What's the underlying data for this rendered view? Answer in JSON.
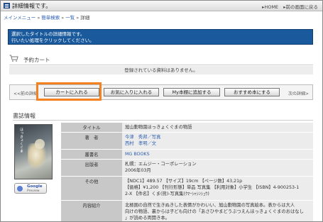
{
  "header": {
    "title": "詳細情報です。",
    "home_link": "▸HOME",
    "back_link": "▸前の画面に戻る"
  },
  "breadcrumb": {
    "items": [
      "メインメニュー",
      "簡単検索",
      "一覧"
    ],
    "separator": "»",
    "current": "詳細"
  },
  "info": {
    "line1": "選択したタイトルの詳細情報です。",
    "line2": "行いたい処理をクリックしてください。"
  },
  "cart": {
    "title": "予約カート",
    "empty_message": "登録されている資料はありません。"
  },
  "buttons": {
    "prev": "<<前の詳細",
    "next": "次の詳細>",
    "add_cart": "カートに入れる",
    "favorite": "お気に入りに入れる",
    "bookshelf": "My本棚に追加する",
    "recommend": "おすすめ本にする"
  },
  "book": {
    "section_title": "書誌情報",
    "cover_text": "ほっきょくぐま",
    "google_preview": {
      "line1": "Google",
      "line2": "Preview"
    },
    "rows": [
      {
        "key": "タイトル",
        "value_lines": [
          "旭山動物園ほっきょくぐまの物語"
        ]
      },
      {
        "key": "著　者",
        "value_lines": [
          "今津　秀邦／写真",
          "西村　孝明／文"
        ],
        "is_link": true
      },
      {
        "key": "叢書名",
        "value_lines": [
          "MG BOOKS"
        ],
        "is_link": true
      },
      {
        "key": "出版者",
        "value_lines": [
          "札幌：エムジー・コーポレーション",
          "2006年03月"
        ]
      },
      {
        "key": "その他",
        "value_lines": [
          "【NDC1】489.57 【サイズ】19cm 【ページ数】43,21p",
          "【価格】¥1,200 【刊行形態】単品 写真集 【利用対象】小学生 【ISBN】4-900253-1",
          "2-X 【件名】くま(熊)-写真集(ｸﾏｰｼｬｼﾝｼｭｳ)"
        ]
      },
      {
        "key": "内容紹介",
        "value_lines": [
          "北極圏の自然で生きぬきした表情がかわいい、旭山動物園の写真絵本。表からは大人",
          "向けの物語、裏からは子ども向けの「あさひやまどうぶつえんほっきょくぐまのおはなし",
          "」が読める両開き本。"
        ]
      }
    ]
  },
  "colors": {
    "info_bg": "#1a5a9c",
    "highlight": "#f58220",
    "link": "#2a5db0"
  }
}
